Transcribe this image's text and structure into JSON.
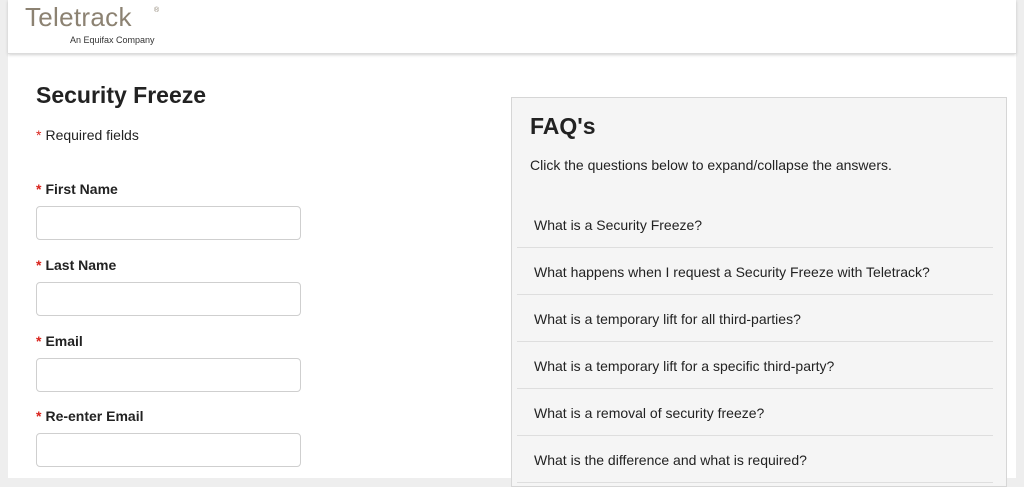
{
  "header": {
    "logo_text": "Teletrack",
    "logo_tm": "®",
    "logo_tagline": "An Equifax Company"
  },
  "form": {
    "title": "Security Freeze",
    "required_star": "*",
    "required_note": "Required fields",
    "fields": [
      {
        "label": "First Name",
        "value": ""
      },
      {
        "label": "Last Name",
        "value": ""
      },
      {
        "label": "Email",
        "value": ""
      },
      {
        "label": "Re-enter Email",
        "value": ""
      }
    ]
  },
  "faq": {
    "title": "FAQ's",
    "intro": "Click the questions below to expand/collapse the answers.",
    "items": [
      "What is a Security Freeze?",
      "What happens when I request a Security Freeze with Teletrack?",
      "What is a temporary lift for all third-parties?",
      "What is a temporary lift for a specific third-party?",
      "What is a removal of security freeze?",
      "What is the difference and what is required?"
    ]
  },
  "colors": {
    "brand": "#8c8272",
    "required": "#d9231c"
  }
}
